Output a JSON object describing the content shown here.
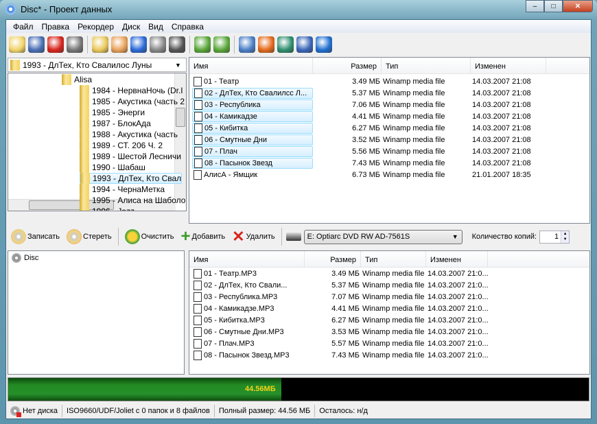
{
  "window": {
    "title": "Disc* - Проект данных",
    "minimize": "–",
    "maximize": "□",
    "close": "✕"
  },
  "menu": [
    "Файл",
    "Правка",
    "Рекордер",
    "Диск",
    "Вид",
    "Справка"
  ],
  "toolbar": [
    "open-folder-icon",
    "save-icon",
    "delete-icon",
    "print-icon",
    "burn-disc-icon",
    "erase-disc-icon",
    "blue-square-icon",
    "disc-info-icon",
    "drive-info-icon",
    "disc-down-icon",
    "disc-up-icon",
    "settings-gear-icon",
    "web-update-icon",
    "globe-cursor-icon",
    "help-icon",
    "info-icon"
  ],
  "folder_combo": {
    "value": "1993 - ДлТех, Кто Свалилос Луны"
  },
  "tree": {
    "root": "Alisa",
    "items": [
      "1984 - НервнаНочь (Dr.I",
      "1985 - Акустика (часть 2",
      "1985 - Энерги",
      "1987 - БлокАда",
      "1988 - Акустика (часть",
      "1989 - СТ. 206 Ч. 2",
      "1989 - Шестой Лесничи",
      "1990 - Шабаш",
      "1993 - ДлТех, Кто Свал",
      "1994 - ЧернаМетка",
      "1995 - Алиса на Шаболо",
      "1996 - Jazz"
    ],
    "selected_index": 8
  },
  "source_list": {
    "columns": [
      "Имя",
      "Размер",
      "Тип",
      "Изменен"
    ],
    "rows": [
      [
        "01 - Театр",
        "3.49 МБ",
        "Winamp media file",
        "14.03.2007 21:08"
      ],
      [
        "02 - ДлТех, Кто Свалилсс Л...",
        "5.37 МБ",
        "Winamp media file",
        "14.03.2007 21:08"
      ],
      [
        "03 - Республика",
        "7.06 МБ",
        "Winamp media file",
        "14.03.2007 21:08"
      ],
      [
        "04 - Камикадзе",
        "4.41 МБ",
        "Winamp media file",
        "14.03.2007 21:08"
      ],
      [
        "05 - Кибитка",
        "6.27 МБ",
        "Winamp media file",
        "14.03.2007 21:08"
      ],
      [
        "06 - Смутные Дни",
        "3.52 МБ",
        "Winamp media file",
        "14.03.2007 21:08"
      ],
      [
        "07 - Плач",
        "5.56 МБ",
        "Winamp media file",
        "14.03.2007 21:08"
      ],
      [
        "08 - Пасынок Звезд",
        "7.43 МБ",
        "Winamp media file",
        "14.03.2007 21:08"
      ],
      [
        "АлисА - Ямщик",
        "6.73 МБ",
        "Winamp media file",
        "21.01.2007 18:35"
      ]
    ],
    "selected_rows": [
      1,
      2,
      3,
      4,
      5,
      6,
      7
    ]
  },
  "actions": {
    "burn": "Записать",
    "erase": "Стереть",
    "clear": "Очистить",
    "add": "Добавить",
    "remove": "Удалить",
    "drive": "E: Optiarc DVD RW AD-7561S",
    "copies_label": "Количество копий:",
    "copies": "1"
  },
  "disc_tree": {
    "root": "Disc"
  },
  "disc_list": {
    "columns": [
      "Имя",
      "Размер",
      "Тип",
      "Изменен"
    ],
    "rows": [
      [
        "01 - Театр.MP3",
        "3.49 МБ",
        "Winamp media file",
        "14.03.2007 21:0..."
      ],
      [
        "02 - ДлТех, Кто Свали...",
        "5.37 МБ",
        "Winamp media file",
        "14.03.2007 21:0..."
      ],
      [
        "03 - Республика.MP3",
        "7.07 МБ",
        "Winamp media file",
        "14.03.2007 21:0..."
      ],
      [
        "04 - Камикадзе.MP3",
        "4.41 МБ",
        "Winamp media file",
        "14.03.2007 21:0..."
      ],
      [
        "05 - Кибитка.MP3",
        "6.27 МБ",
        "Winamp media file",
        "14.03.2007 21:0..."
      ],
      [
        "06 - Смутные Дни.MP3",
        "3.53 МБ",
        "Winamp media file",
        "14.03.2007 21:0..."
      ],
      [
        "07 - Плач.MP3",
        "5.57 МБ",
        "Winamp media file",
        "14.03.2007 21:0..."
      ],
      [
        "08 - Пасынок Звезд.MP3",
        "7.43 МБ",
        "Winamp media file",
        "14.03.2007 21:0..."
      ]
    ]
  },
  "capacity": {
    "label": "44.56МБ",
    "fill_fraction": 0.47,
    "fill_color": "#238a23",
    "label_color": "#f5d21a"
  },
  "status": {
    "disc": "Нет диска",
    "fs": "ISO9660/UDF/Joliet с 0 папок и 8 файлов",
    "total": "Полный размер: 44.56 МБ",
    "remaining": "Осталось: н/д"
  }
}
